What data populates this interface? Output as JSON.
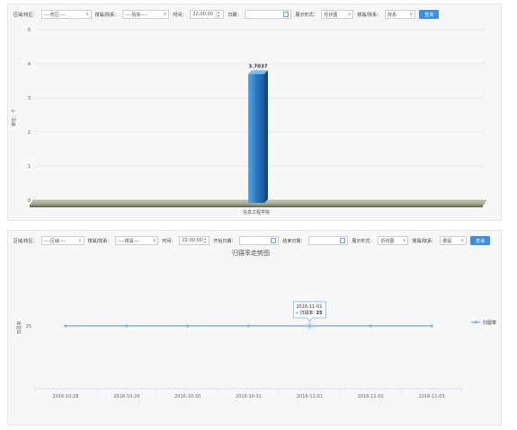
{
  "top_panel": {
    "toolbar": {
      "campus_label": "区域/校区：",
      "campus_value": "----校区----",
      "building_label": "楼属/院系：",
      "building_value": "----院系----",
      "time_label": "时间：",
      "time_value": "22:00:00",
      "date_label": "日期：",
      "date_value": "",
      "display_label": "展示形式：",
      "display_value": "柱状图",
      "dept_label": "楼属/院系：",
      "dept_value": "院系",
      "query_label": "查询"
    },
    "chart_data": {
      "type": "bar",
      "categories": [
        "信息工程学院"
      ],
      "values": [
        3.7037
      ],
      "data_labels": [
        "3.7037"
      ],
      "ylabel": "单位：个",
      "ylim": [
        0,
        5
      ],
      "yticks": [
        "0",
        "1",
        "2",
        "3",
        "4",
        "5"
      ],
      "grid": true,
      "bar_color": "#2b78c2"
    }
  },
  "bottom_panel": {
    "toolbar": {
      "campus_label": "区域/校区：",
      "campus_value": "----区域----",
      "building_label": "楼属/院系：",
      "building_value": "----楼属----",
      "time_label": "时间：",
      "time_value": "22:00:00",
      "start_label": "开始日期：",
      "start_value": "",
      "end_label": "结束日期：",
      "end_value": "",
      "display_label": "展示形式：",
      "display_value": "折线图",
      "dept_label": "楼属/院系：",
      "dept_value": "楼属",
      "query_label": "查询"
    },
    "chart_data": {
      "type": "line",
      "title": "归寝率走势图",
      "ylabel": "归寝率",
      "x": [
        "2016-10-28",
        "2016-10-29",
        "2016-10-30",
        "2016-10-31",
        "2016-11-01",
        "2016-11-02",
        "2016-11-03"
      ],
      "series": [
        {
          "name": "归寝率",
          "values": [
            25,
            25,
            25,
            25,
            25,
            25,
            25
          ],
          "color": "#7cb5ec"
        }
      ],
      "yticks": [
        "25"
      ],
      "tooltip": {
        "date": "2016-11-01",
        "series": "归寝率",
        "value": "25"
      }
    }
  }
}
